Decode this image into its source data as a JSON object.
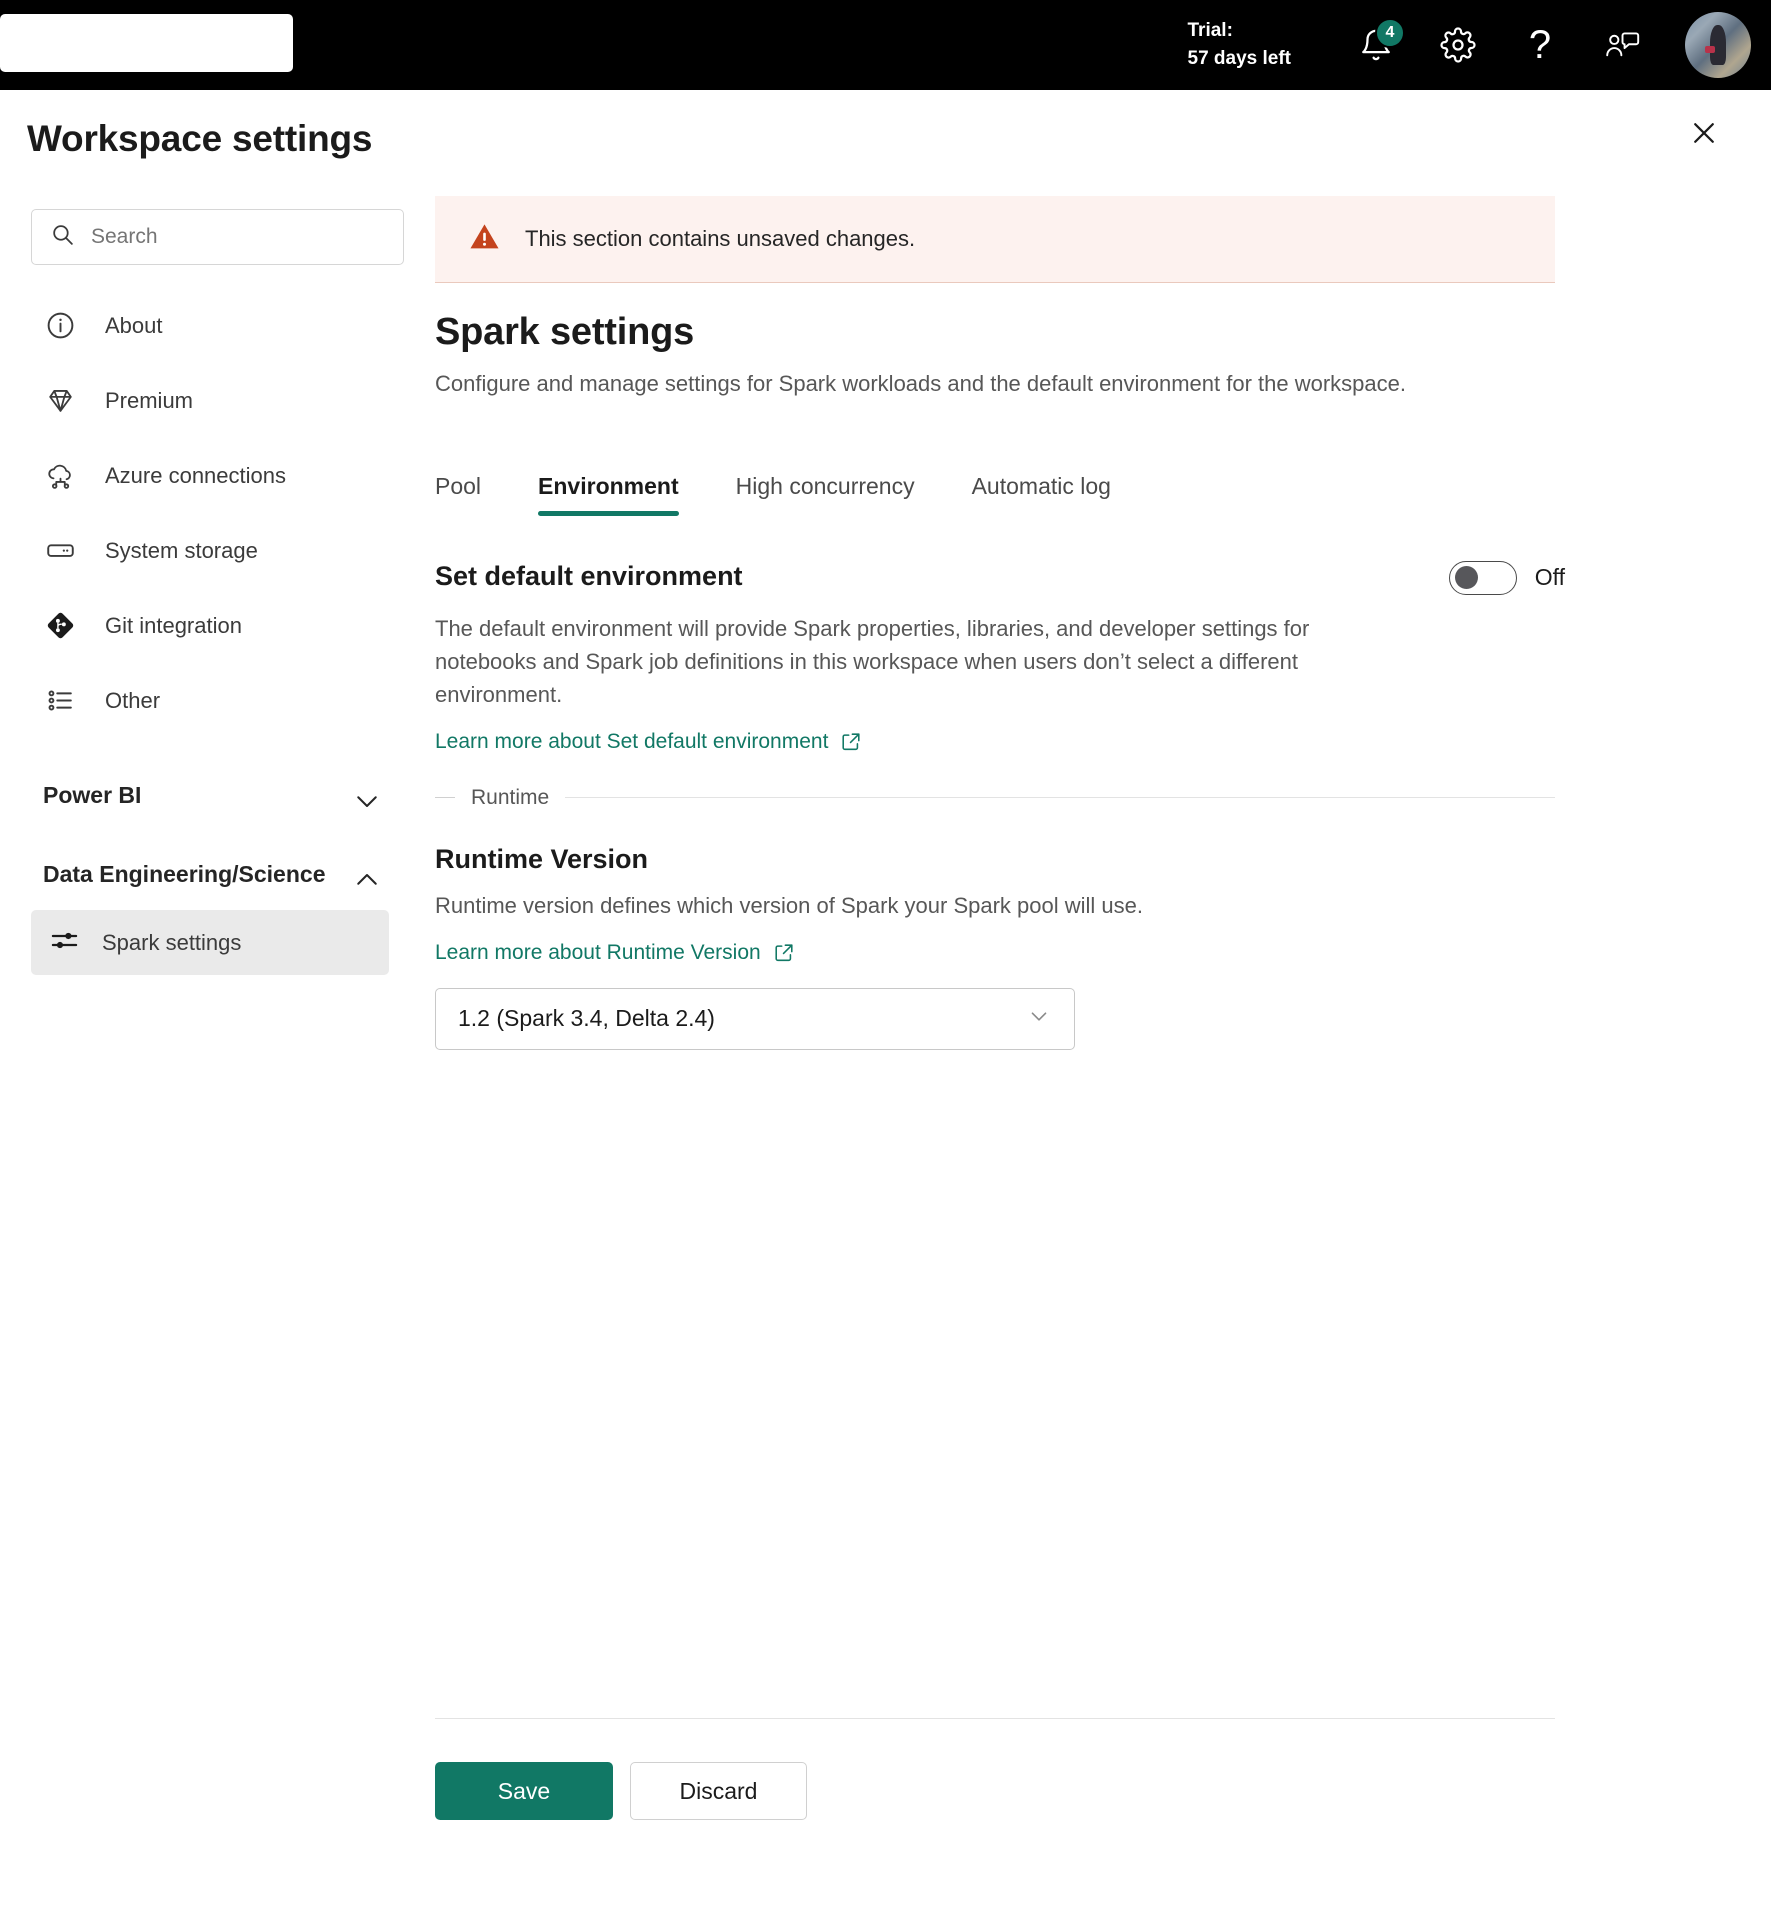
{
  "topbar": {
    "search_value": "",
    "search_placeholder": "",
    "trial_label": "Trial:",
    "trial_days": "57 days left",
    "notification_count": "4",
    "help_glyph": "?",
    "accent_color": "#117865"
  },
  "header": {
    "title": "Workspace settings"
  },
  "sidebar": {
    "search_placeholder": "Search",
    "search_value": "",
    "items": [
      {
        "label": "About",
        "icon": "info-circle-icon"
      },
      {
        "label": "Premium",
        "icon": "diamond-icon"
      },
      {
        "label": "Azure connections",
        "icon": "cloud-connection-icon"
      },
      {
        "label": "System storage",
        "icon": "storage-icon"
      },
      {
        "label": "Git integration",
        "icon": "git-diamond-icon"
      },
      {
        "label": "Other",
        "icon": "list-icon"
      }
    ],
    "groups": [
      {
        "title": "Power BI",
        "expanded": false,
        "chevron": "chevron-down-icon",
        "items": []
      },
      {
        "title": "Data Engineering/Science",
        "expanded": true,
        "chevron": "chevron-up-icon",
        "items": [
          {
            "label": "Spark settings",
            "icon": "sliders-icon",
            "selected": true
          }
        ]
      }
    ]
  },
  "main": {
    "alert": {
      "text": "This section contains unsaved changes.",
      "icon": "warning-triangle-icon",
      "bg_color": "#fdf2ef",
      "icon_color": "#c4431d"
    },
    "section_title": "Spark settings",
    "section_desc": "Configure and manage settings for Spark workloads and the default environment for the workspace.",
    "tabs": [
      {
        "label": "Pool",
        "active": false
      },
      {
        "label": "Environment",
        "active": true
      },
      {
        "label": "High concurrency",
        "active": false
      },
      {
        "label": "Automatic log",
        "active": false
      }
    ],
    "default_environment": {
      "label": "Set default environment",
      "toggle_state": "Off",
      "toggle_on": false,
      "description": "The default environment will provide Spark properties, libraries, and developer settings for notebooks and Spark job definitions in this workspace when users don’t select a different environment.",
      "learn_more": "Learn more about Set default environment",
      "learn_more_icon": "external-link-icon"
    },
    "runtime_divider": "Runtime",
    "runtime": {
      "heading": "Runtime Version",
      "description": "Runtime version defines which version of Spark your Spark pool will use.",
      "learn_more": "Learn more about Runtime Version",
      "learn_more_icon": "external-link-icon",
      "selected_version": "1.2 (Spark 3.4, Delta 2.4)"
    },
    "actions": {
      "save_label": "Save",
      "discard_label": "Discard"
    }
  }
}
